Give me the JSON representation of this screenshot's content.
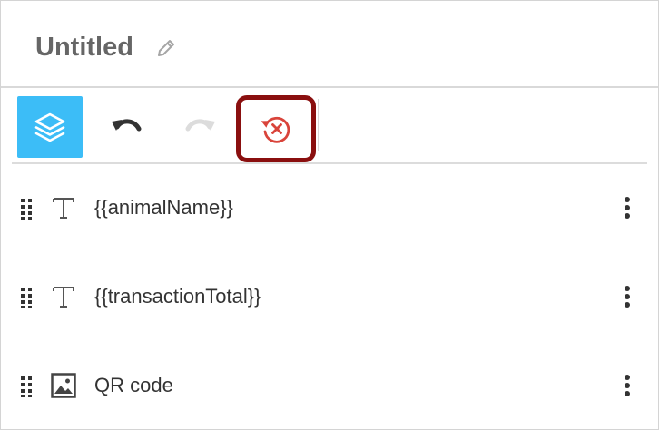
{
  "header": {
    "title": "Untitled"
  },
  "toolbar": {
    "buttons": [
      {
        "icon": "layers-icon",
        "active": true
      },
      {
        "icon": "undo-icon"
      },
      {
        "icon": "redo-icon",
        "disabled": true
      },
      {
        "icon": "reset-history-icon",
        "highlighted": true
      }
    ]
  },
  "layers": [
    {
      "type_icon": "text-icon",
      "label": "{{animalName}}"
    },
    {
      "type_icon": "text-icon",
      "label": "{{transactionTotal}}"
    },
    {
      "type_icon": "image-icon",
      "label": "QR code"
    }
  ],
  "colors": {
    "accent": "#3cbdf7",
    "highlight_border": "#8a0f0f",
    "reset_icon": "#d9443b",
    "disabled_icon": "#dcdcdc",
    "title": "#666666"
  }
}
